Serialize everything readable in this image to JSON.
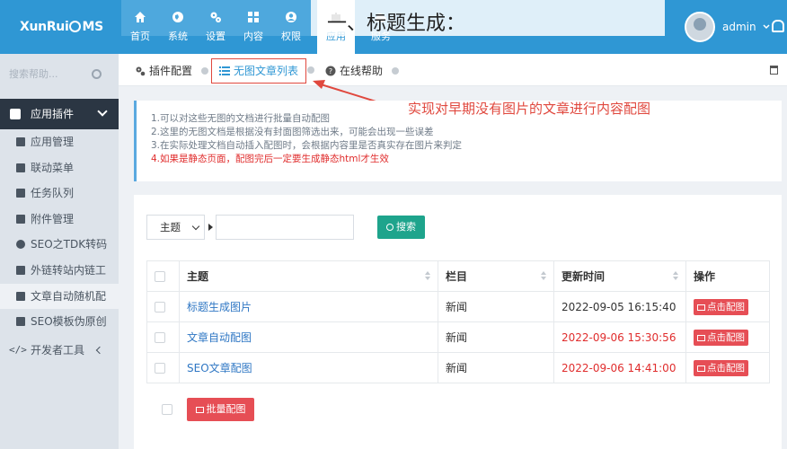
{
  "app": {
    "logo_text_left": "XunRui",
    "logo_text_right": "MS",
    "overlay_title": "一、标题生成：",
    "user_name": "admin"
  },
  "nav": [
    {
      "label": "首页",
      "icon": "home-icon"
    },
    {
      "label": "系统",
      "icon": "globe-icon"
    },
    {
      "label": "设置",
      "icon": "gears-icon"
    },
    {
      "label": "内容",
      "icon": "grid-icon"
    },
    {
      "label": "权限",
      "icon": "user-icon"
    },
    {
      "label": "应用",
      "icon": "puzzle-icon",
      "active": true
    },
    {
      "label": "服务",
      "icon": "cloud-icon"
    }
  ],
  "sidebar": {
    "search_placeholder": "搜索帮助...",
    "section_title": "应用插件",
    "items": [
      {
        "label": "应用管理",
        "icon": "folder-icon"
      },
      {
        "label": "联动菜单",
        "icon": "columns-icon"
      },
      {
        "label": "任务队列",
        "icon": "list-icon"
      },
      {
        "label": "附件管理",
        "icon": "folder-icon"
      },
      {
        "label": "SEO之TDK转码",
        "icon": "support-icon"
      },
      {
        "label": "外链转站内链工",
        "icon": "sitemap-icon"
      },
      {
        "label": "文章自动随机配",
        "icon": "image-icon",
        "active": true
      },
      {
        "label": "SEO模板伪原创",
        "icon": "cube-icon"
      }
    ],
    "dev_tools": "开发者工具"
  },
  "tabs": [
    {
      "label": "插件配置",
      "icon": "cogs-icon"
    },
    {
      "label": "无图文章列表",
      "icon": "list-icon",
      "active": true
    },
    {
      "label": "在线帮助",
      "icon": "question-icon"
    }
  ],
  "annotation": "实现对早期没有图片的文章进行内容配图",
  "notes": [
    {
      "text": "1.可以对这些无图的文档进行批量自动配图",
      "red": false
    },
    {
      "text": "2.这里的无图文档是根据没有封面图筛选出来，可能会出现一些误差",
      "red": false
    },
    {
      "text": "3.在实际处理文档自动插入配图时，会根据内容里是否真实存在图片来判定",
      "red": false
    },
    {
      "text": "4.如果是静态页面，配图完后一定要生成静态html才生效",
      "red": true
    }
  ],
  "filter": {
    "select_value": "主题",
    "search_button": "搜索"
  },
  "table": {
    "headers": [
      "主题",
      "栏目",
      "更新时间",
      "操作"
    ],
    "rows": [
      {
        "title": "标题生成图片",
        "category": "新闻",
        "time": "2022-09-05 16:15:40",
        "time_red": false,
        "action": "点击配图"
      },
      {
        "title": "文章自动配图",
        "category": "新闻",
        "time": "2022-09-06 15:30:56",
        "time_red": true,
        "action": "点击配图"
      },
      {
        "title": "SEO文章配图",
        "category": "新闻",
        "time": "2022-09-06 14:41:00",
        "time_red": true,
        "action": "点击配图"
      }
    ]
  },
  "batch_button": "批量配图",
  "colors": {
    "brand": "#2f97d4",
    "danger": "#e64e55",
    "success": "#1ea48c",
    "annotation": "#e0483e"
  }
}
